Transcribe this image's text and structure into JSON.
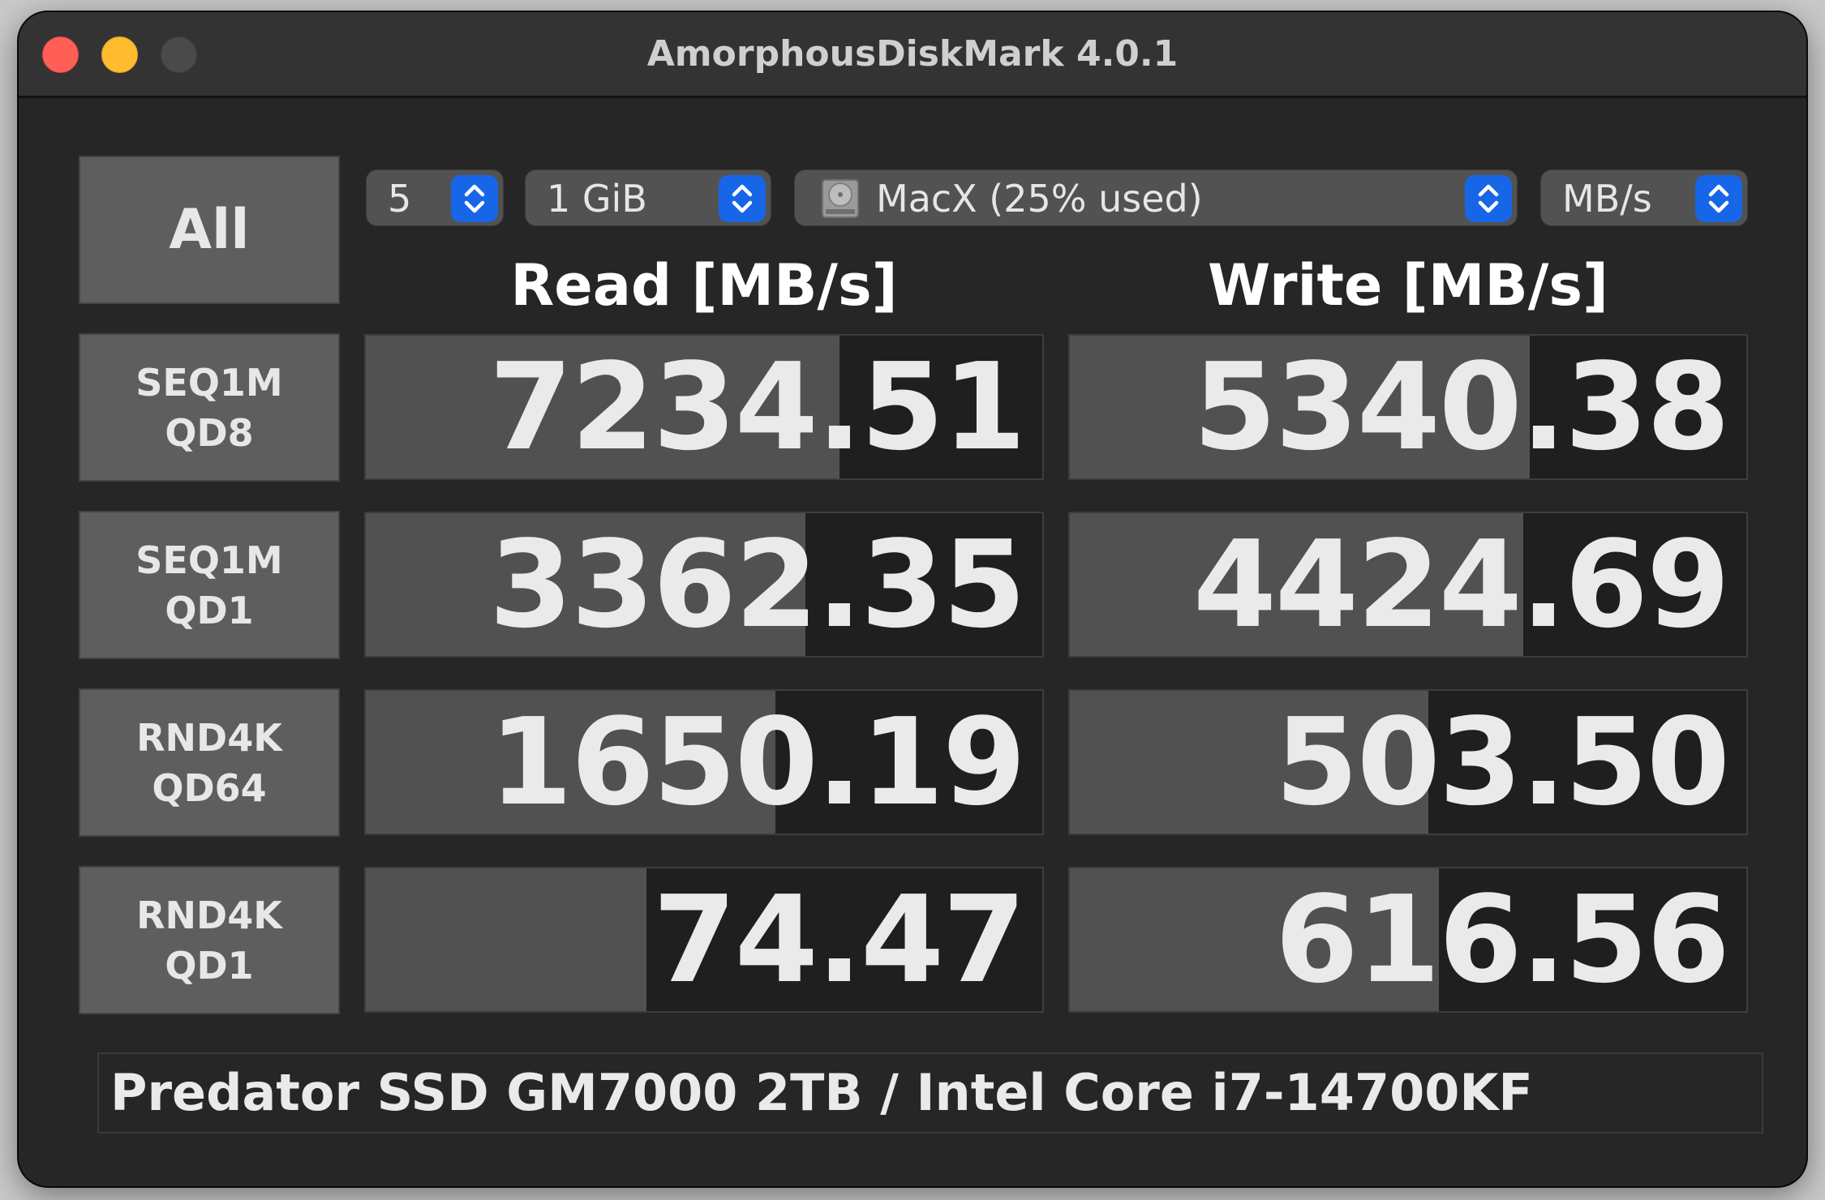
{
  "window": {
    "title": "AmorphousDiskMark 4.0.1"
  },
  "controls": {
    "all_label": "All",
    "count_value": "5",
    "size_value": "1 GiB",
    "disk_value": "MacX (25% used)",
    "unit_value": "MB/s"
  },
  "columns": {
    "read": "Read [MB/s]",
    "write": "Write [MB/s]"
  },
  "tests": [
    {
      "line1": "SEQ1M",
      "line2": "QD8",
      "read": "7234.51",
      "write": "5340.38",
      "read_fill": 0.7,
      "write_fill": 0.68
    },
    {
      "line1": "SEQ1M",
      "line2": "QD1",
      "read": "3362.35",
      "write": "4424.69",
      "read_fill": 0.65,
      "write_fill": 0.67
    },
    {
      "line1": "RND4K",
      "line2": "QD64",
      "read": "1650.19",
      "write": "503.50",
      "read_fill": 0.605,
      "write_fill": 0.53
    },
    {
      "line1": "RND4K",
      "line2": "QD1",
      "read": "74.47",
      "write": "616.56",
      "read_fill": 0.415,
      "write_fill": 0.545
    }
  ],
  "comment": "Predator SSD GM7000 2TB / Intel Core i7-14700KF",
  "colors": {
    "close": "#ff5f57",
    "minimize": "#febc2e",
    "accent": "#1766e8"
  }
}
